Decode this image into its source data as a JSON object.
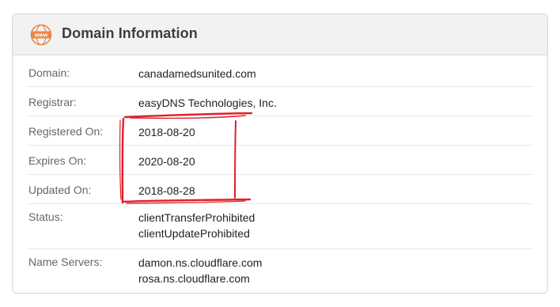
{
  "header": {
    "icon": "www-icon",
    "icon_text": "www",
    "title": "Domain Information"
  },
  "rows": [
    {
      "label": "Domain:",
      "values": [
        "canadamedsunited.com"
      ]
    },
    {
      "label": "Registrar:",
      "values": [
        "easyDNS Technologies, Inc."
      ]
    },
    {
      "label": "Registered On:",
      "values": [
        "2018-08-20"
      ]
    },
    {
      "label": "Expires On:",
      "values": [
        "2020-08-20"
      ]
    },
    {
      "label": "Updated On:",
      "values": [
        "2018-08-28"
      ]
    },
    {
      "label": "Status:",
      "values": [
        "clientTransferProhibited",
        "clientUpdateProhibited"
      ]
    },
    {
      "label": "Name Servers:",
      "values": [
        "damon.ns.cloudflare.com",
        "rosa.ns.cloudflare.com"
      ]
    }
  ],
  "colors": {
    "accent_icon": "#e8864a",
    "annotation": "#e0202a"
  }
}
